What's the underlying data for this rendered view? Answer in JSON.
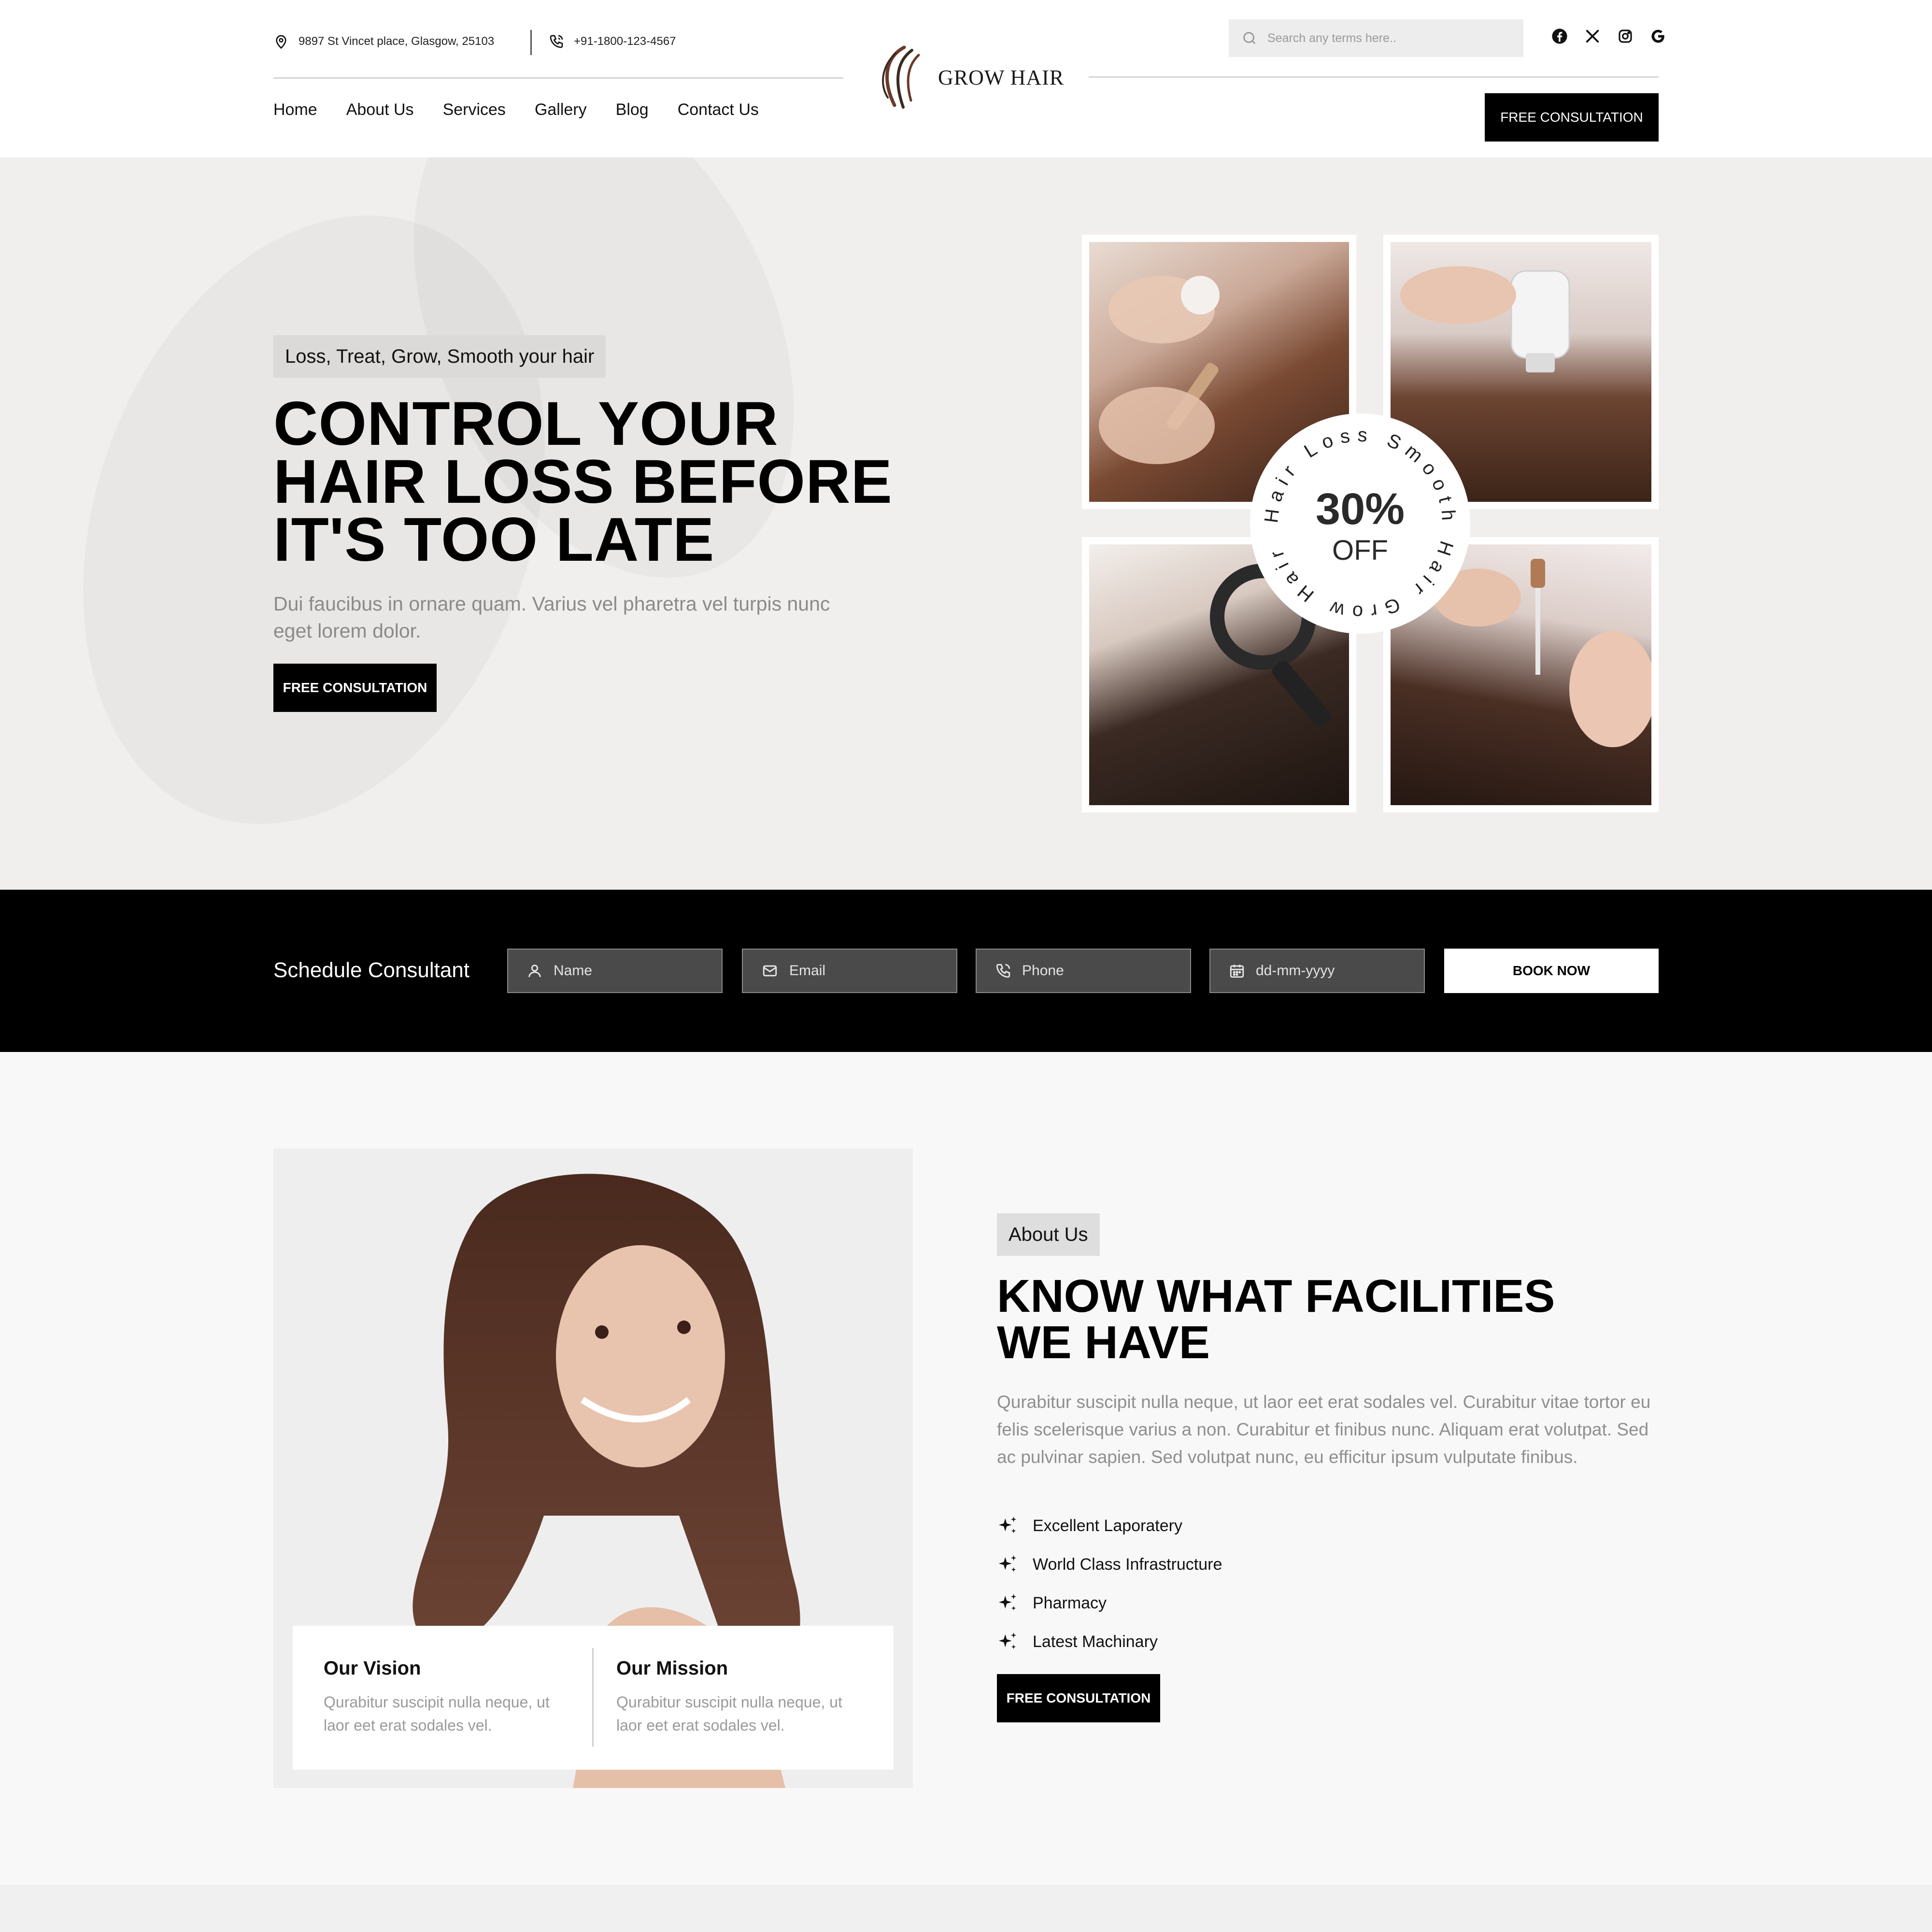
{
  "topbar": {
    "address": "9897 St Vincet place, Glasgow, 25103",
    "phone": "+91-1800-123-4567"
  },
  "brand": {
    "name": "GROW HAIR"
  },
  "nav": {
    "items": [
      {
        "label": "Home"
      },
      {
        "label": "About Us"
      },
      {
        "label": "Services"
      },
      {
        "label": "Gallery"
      },
      {
        "label": "Blog"
      },
      {
        "label": "Contact Us"
      }
    ]
  },
  "search": {
    "placeholder": "Search any terms here.."
  },
  "socials": [
    "facebook-icon",
    "x-icon",
    "instagram-icon",
    "google-icon"
  ],
  "header": {
    "cta_label": "FREE CONSULTATION"
  },
  "hero": {
    "tagline": "Loss, Treat, Grow, Smooth your hair",
    "title_line1": "CONTROL YOUR",
    "title_line2": "HAIR LOSS BEFORE",
    "title_line3": "IT'S TOO LATE",
    "description": "Dui faucibus in ornare quam. Varius vel pharetra vel turpis nunc eget lorem dolor.",
    "cta_label": "FREE CONSULTATION",
    "badge": {
      "value": "30%",
      "label": "OFF",
      "ring_text": "Hair Loss Smooth Hair Grow Hair"
    }
  },
  "booking": {
    "title": "Schedule Consultant",
    "fields": {
      "name": "Name",
      "email": "Email",
      "phone": "Phone",
      "date": "dd-mm-yyyy"
    },
    "submit_label": "BOOK NOW"
  },
  "about": {
    "tag": "About Us",
    "title_line1": "KNOW WHAT FACILITIES",
    "title_line2": "WE HAVE",
    "description": "Qurabitur suscipit nulla neque, ut laor eet erat sodales vel. Curabitur vitae tortor eu felis scelerisque varius a non. Curabitur et finibus nunc. Aliquam erat volutpat. Sed ac pulvinar sapien. Sed volutpat nunc, eu efficitur ipsum vulputate finibus.",
    "features": [
      "Excellent Laporatery",
      "World Class Infrastructure",
      "Pharmacy",
      "Latest Machinary"
    ],
    "cta_label": "FREE CONSULTATION",
    "vision": {
      "title": "Our Vision",
      "text": "Qurabitur suscipit nulla neque, ut laor eet erat sodales vel."
    },
    "mission": {
      "title": "Our Mission",
      "text": "Qurabitur suscipit nulla neque, ut laor eet erat sodales vel."
    }
  },
  "colors": {
    "primary": "#000000",
    "hero_bg": "#f1efed",
    "muted_text": "#8a8a8a",
    "logo_accent": "#6b3a2a"
  }
}
